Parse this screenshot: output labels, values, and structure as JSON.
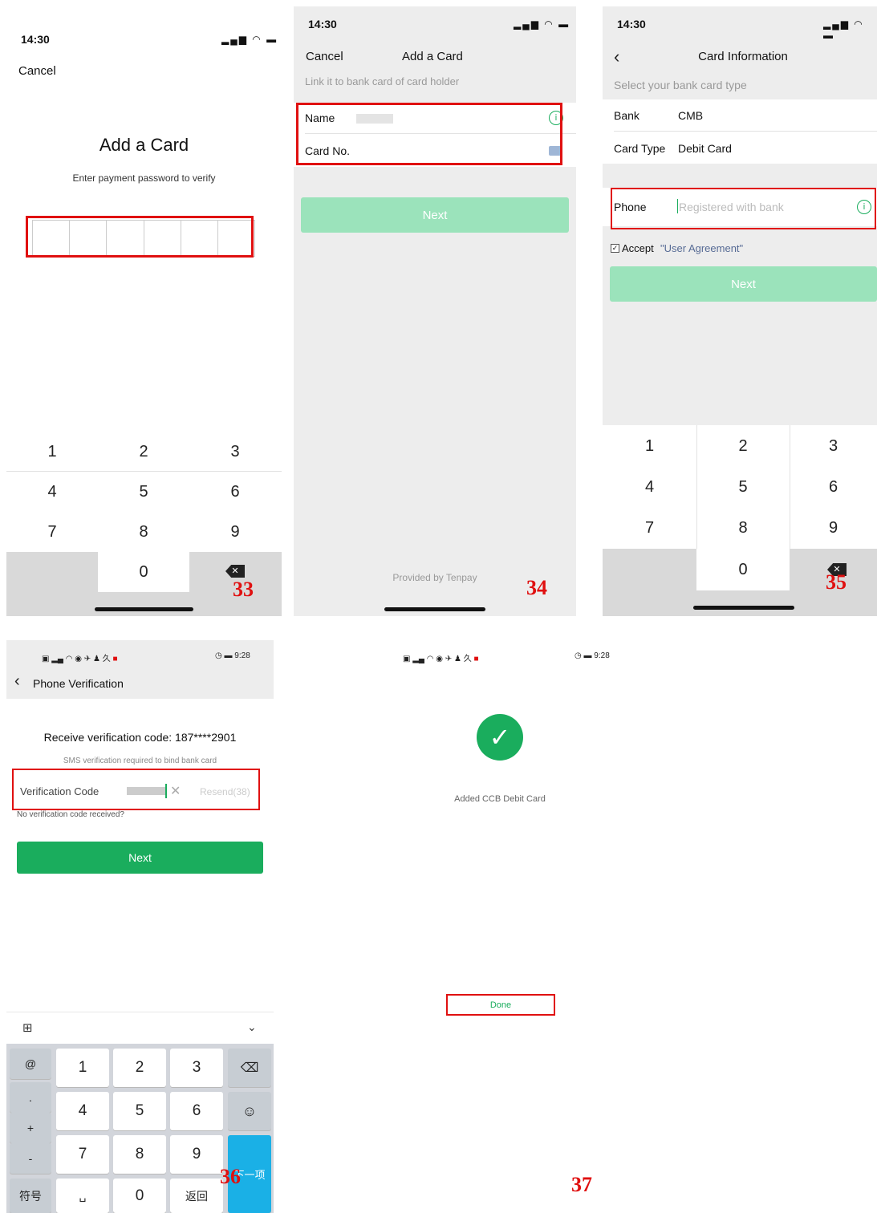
{
  "status": {
    "time": "14:30",
    "android_time": "9:28"
  },
  "screen33": {
    "cancel": "Cancel",
    "title": "Add a Card",
    "subtitle": "Enter payment password to verify",
    "keys": [
      "1",
      "2",
      "3",
      "4",
      "5",
      "6",
      "7",
      "8",
      "9",
      "0"
    ],
    "fig": "33"
  },
  "screen34": {
    "cancel": "Cancel",
    "title": "Add a Card",
    "subtitle": "Link it to bank card of card holder",
    "name_label": "Name",
    "card_label": "Card No.",
    "next": "Next",
    "footer": "Provided by Tenpay",
    "fig": "34"
  },
  "screen35": {
    "title": "Card Information",
    "subtitle": "Select your bank card type",
    "bank_label": "Bank",
    "bank_value": "CMB",
    "type_label": "Card Type",
    "type_value": "Debit Card",
    "phone_label": "Phone",
    "phone_placeholder": "Registered with bank",
    "accept_text": "Accept",
    "agreement": "\"User Agreement\"",
    "next": "Next",
    "keys": [
      "1",
      "2",
      "3",
      "4",
      "5",
      "6",
      "7",
      "8",
      "9",
      "0"
    ],
    "fig": "35"
  },
  "screen36": {
    "title": "Phone Verification",
    "receive": "Receive verification code: 187****2901",
    "sms_note": "SMS verification required to bind bank card",
    "code_label": "Verification Code",
    "resend": "Resend(38)",
    "no_code": "No verification code received?",
    "next": "Next",
    "kb_left": [
      "@",
      ".",
      "+",
      "-"
    ],
    "kb_digits": [
      "1",
      "2",
      "3",
      "4",
      "5",
      "6",
      "7",
      "8",
      "9",
      "0"
    ],
    "kb_symbols": "符号",
    "kb_return": "返回",
    "kb_next_item": "下一项",
    "fig": "36"
  },
  "screen37": {
    "message": "Added CCB Debit Card",
    "done": "Done",
    "fig": "37"
  },
  "colors": {
    "red": "#e01010",
    "green": "#1aad5d",
    "light_green": "#9be3bb"
  }
}
